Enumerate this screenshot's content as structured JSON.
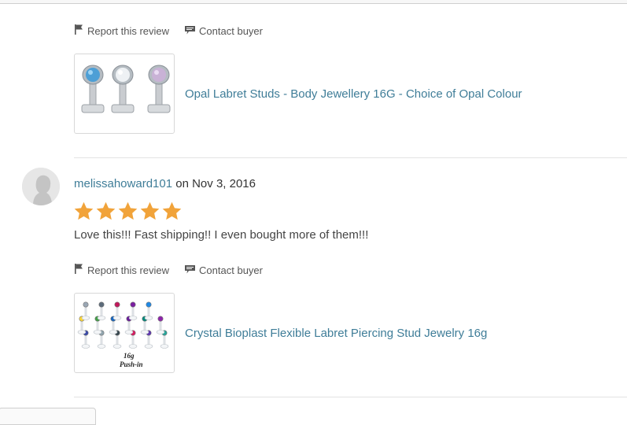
{
  "actions": {
    "report_label": "Report this review",
    "contact_label": "Contact buyer"
  },
  "reviews": [
    {
      "product": {
        "title": "Opal Labret Studs - Body Jewellery 16G - Choice of Opal Colour"
      }
    },
    {
      "reviewer": "melissahoward101",
      "date_text": "on Nov 3, 2016",
      "rating": 5,
      "rating_max": 5,
      "text": "Love this!!! Fast shipping!! I even bought more of them!!!",
      "product": {
        "title": "Crystal Bioplast Flexible Labret Piercing Stud Jewelry 16g",
        "image_label_top": "16g",
        "image_label_bottom": "Push-in"
      }
    }
  ],
  "colors": {
    "link": "#3f7d98",
    "star": "#f1a33a",
    "text": "#444444"
  },
  "icons": {
    "report": "flag-icon",
    "contact": "message-icon",
    "avatar": "user-silhouette-icon",
    "star": "star-icon"
  }
}
